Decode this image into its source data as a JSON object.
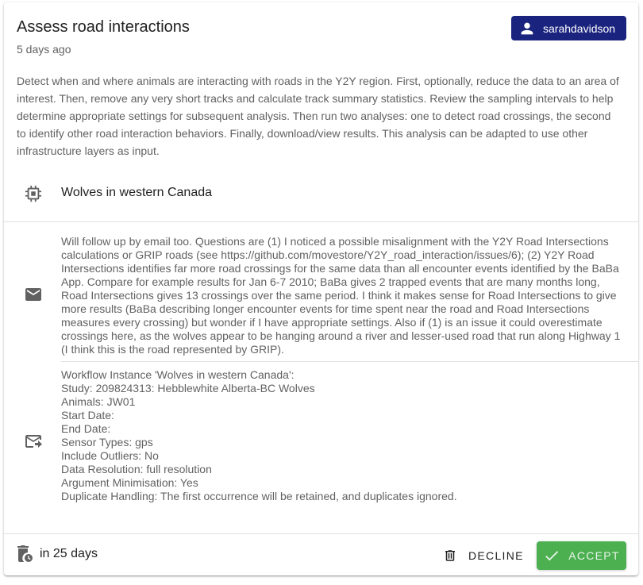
{
  "header": {
    "title": "Assess road interactions",
    "time_ago": "5 days ago",
    "user": "sarahdavidson"
  },
  "description": "Detect when and where animals are interacting with roads in the Y2Y region. First, optionally, reduce the data to an area of interest. Then, remove any very short tracks and calculate track summary statistics. Review the sampling intervals to help determine appropriate settings for subsequent analysis. Then run two analyses: one to detect road crossings, the second to identify other road interaction behaviors. Finally, download/view results. This analysis can be adapted to use other infrastructure layers as input.",
  "workflow": {
    "name": "Wolves in western Canada"
  },
  "message": {
    "text": "Will follow up by email too. Questions are (1) I noticed a possible misalignment with the Y2Y Road Intersections calculations or GRIP roads (see https://github.com/movestore/Y2Y_road_interaction/issues/6); (2) Y2Y Road Intersections identifies far more road crossings for the same data than all encounter events identified by the BaBa App. Compare for example results for Jan 6-7 2010; BaBa gives 2 trapped events that are many months long, Road Intersections gives 13 crossings over the same period. I think it makes sense for Road Intersections to give more results (BaBa describing longer encounter events for time spent near the road and Road Intersections measures every crossing) but wonder if I have appropriate settings. Also if (1) is an issue it could overestimate crossings here, as the wolves appear to be hanging around a river and lesser-used road that run along Highway 1 (I think this is the road represented by GRIP)."
  },
  "instance": {
    "lines": [
      "Workflow Instance 'Wolves in western Canada':",
      "Study: 209824313: Hebblewhite Alberta-BC Wolves",
      "Animals: JW01",
      "Start Date:",
      "End Date:",
      "Sensor Types: gps",
      "Include Outliers: No",
      "Data Resolution: full resolution",
      "Argument Minimisation: Yes",
      "Duplicate Handling: The first occurrence will be retained, and duplicates ignored."
    ]
  },
  "footer": {
    "expires": "in 25 days",
    "decline_label": "Decline",
    "accept_label": "Accept"
  },
  "icons": {
    "user": "person-icon",
    "workflow": "chip-icon",
    "message": "email-icon",
    "instance": "email-forward-icon",
    "expires": "delete-clock-icon",
    "decline": "trash-icon",
    "accept": "check-icon"
  },
  "colors": {
    "user_chip": "#1a237e",
    "accept": "#4caf50"
  }
}
